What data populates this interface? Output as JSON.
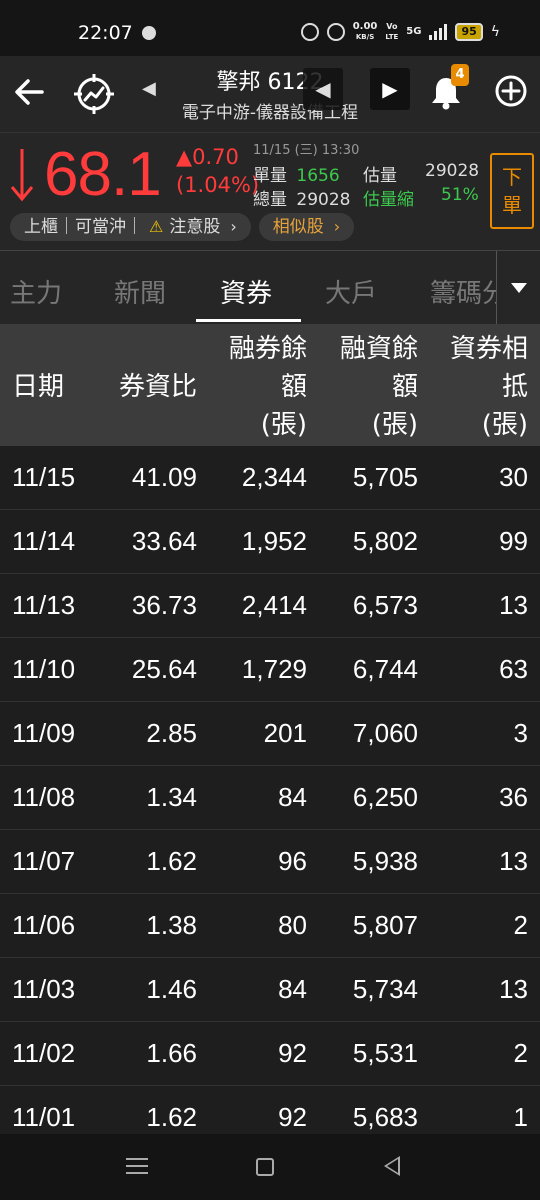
{
  "status_bar": {
    "time": "22:07",
    "net_speed": "0.00",
    "net_unit": "KB/S",
    "vo": "Vo",
    "lte": "LTE",
    "network": "5G",
    "battery": "95"
  },
  "header": {
    "stock_name": "擎邦 6122",
    "industry": "電子中游-儀器設備工程",
    "notification_count": "4"
  },
  "quote": {
    "price": "68.1",
    "change": "▲0.70",
    "change_pct": "(1.04%)",
    "datetime": "11/15 (三) 13:30",
    "single_vol_label": "單量",
    "single_vol": "1656",
    "est_label": "估量",
    "est_vol": "29028",
    "total_vol_label": "總量",
    "total_vol": "29028",
    "est_shrink_label": "估量縮",
    "est_shrink": "51%",
    "order_button": "下單",
    "tag_market": "上櫃｜可當沖｜",
    "tag_warning": "注意股",
    "tag_similar": "相似股",
    "colors": {
      "up": "#ff3b3b",
      "green": "#3cc94d",
      "accent": "#e88b00"
    }
  },
  "tabs": [
    {
      "label": "主力"
    },
    {
      "label": "新聞"
    },
    {
      "label": "資券"
    },
    {
      "label": "大戶"
    },
    {
      "label": "籌碼分"
    }
  ],
  "table": {
    "headers": {
      "date": "日期",
      "ratio": "券資比",
      "short_l1": "融券餘",
      "short_l2": "額",
      "short_l3": "(張)",
      "margin_l1": "融資餘",
      "margin_l2": "額",
      "margin_l3": "(張)",
      "offset_l1": "資券相",
      "offset_l2": "抵",
      "offset_l3": "(張)"
    },
    "rows": [
      {
        "date": "11/15",
        "ratio": "41.09",
        "short": "2,344",
        "margin": "5,705",
        "offset": "30"
      },
      {
        "date": "11/14",
        "ratio": "33.64",
        "short": "1,952",
        "margin": "5,802",
        "offset": "99"
      },
      {
        "date": "11/13",
        "ratio": "36.73",
        "short": "2,414",
        "margin": "6,573",
        "offset": "13"
      },
      {
        "date": "11/10",
        "ratio": "25.64",
        "short": "1,729",
        "margin": "6,744",
        "offset": "63"
      },
      {
        "date": "11/09",
        "ratio": "2.85",
        "short": "201",
        "margin": "7,060",
        "offset": "3"
      },
      {
        "date": "11/08",
        "ratio": "1.34",
        "short": "84",
        "margin": "6,250",
        "offset": "36"
      },
      {
        "date": "11/07",
        "ratio": "1.62",
        "short": "96",
        "margin": "5,938",
        "offset": "13"
      },
      {
        "date": "11/06",
        "ratio": "1.38",
        "short": "80",
        "margin": "5,807",
        "offset": "2"
      },
      {
        "date": "11/03",
        "ratio": "1.46",
        "short": "84",
        "margin": "5,734",
        "offset": "13"
      },
      {
        "date": "11/02",
        "ratio": "1.66",
        "short": "92",
        "margin": "5,531",
        "offset": "2"
      },
      {
        "date": "11/01",
        "ratio": "1.62",
        "short": "92",
        "margin": "5,683",
        "offset": "1"
      }
    ]
  }
}
